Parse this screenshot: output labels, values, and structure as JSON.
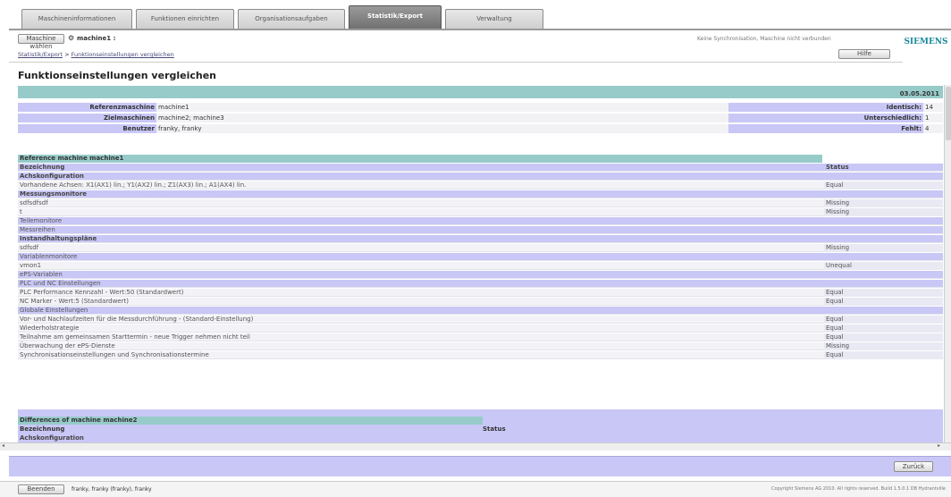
{
  "tabs": [
    {
      "label": "Maschineninformationen"
    },
    {
      "label": "Funktionen einrichten"
    },
    {
      "label": "Organisationsaufgaben"
    },
    {
      "label": "Statistik/Export"
    },
    {
      "label": "Verwaltung"
    }
  ],
  "toolbar": {
    "select_machine_label": "Maschine wählen",
    "machine_name": "machine1 :",
    "sync_status": "Keine Synchronisation, Maschine nicht verbunden",
    "help_label": "Hilfe",
    "brand": "SIEMENS"
  },
  "breadcrumb": {
    "root": "Statistik/Export",
    "separator": " > ",
    "current": "Funktionseinstellungen vergleichen"
  },
  "page_title": "Funktionseinstellungen vergleichen",
  "summary": {
    "date": "03.05.2011",
    "left": [
      {
        "label": "Referenzmaschine",
        "value": "machine1"
      },
      {
        "label": "Zielmaschinen",
        "value": "machine2; machine3"
      },
      {
        "label": "Benutzer",
        "value": "franky, franky"
      }
    ],
    "right": [
      {
        "label": "Identisch:",
        "value": "14"
      },
      {
        "label": "Unterschiedlich:",
        "value": "1"
      },
      {
        "label": "Fehlt:",
        "value": "4"
      }
    ]
  },
  "table1": {
    "title": "Reference machine machine1",
    "col_name": "Bezeichnung",
    "col_status": "Status",
    "rows": [
      {
        "kind": "sec",
        "name": "Achskonfiguration",
        "status": ""
      },
      {
        "kind": "item",
        "name": "Vorhandene Achsen: X1(AX1) lin.; Y1(AX2) lin.; Z1(AX3) lin.; A1(AX4) lin.",
        "status": "Equal"
      },
      {
        "kind": "sec",
        "name": "Messungsmonitore",
        "status": ""
      },
      {
        "kind": "item",
        "name": "sdfsdfsdf",
        "status": "Missing"
      },
      {
        "kind": "item",
        "name": "t",
        "status": "Missing"
      },
      {
        "kind": "sec2",
        "name": "Teilemonitore",
        "status": ""
      },
      {
        "kind": "sec2",
        "name": "Messreihen",
        "status": ""
      },
      {
        "kind": "sec",
        "name": "Instandhaltungspläne",
        "status": ""
      },
      {
        "kind": "item",
        "name": "sdfsdf",
        "status": "Missing"
      },
      {
        "kind": "sec2",
        "name": "Variablenmonitore",
        "status": ""
      },
      {
        "kind": "item",
        "name": "vmon1",
        "status": "Unequal"
      },
      {
        "kind": "sec2",
        "name": "ePS-Variablen",
        "status": ""
      },
      {
        "kind": "sec2",
        "name": "PLC und NC Einstellungen",
        "status": ""
      },
      {
        "kind": "item",
        "name": "PLC Performance Kennzahl - Wert:50 (Standardwert)",
        "status": "Equal"
      },
      {
        "kind": "item",
        "name": "NC Marker - Wert:5 (Standardwert)",
        "status": "Equal"
      },
      {
        "kind": "sec2",
        "name": "Globale Einstellungen",
        "status": ""
      },
      {
        "kind": "item",
        "name": "Vor- und Nachlaufzeiten für die Messdurchführung - (Standard-Einstellung)",
        "status": "Equal"
      },
      {
        "kind": "item",
        "name": "Wiederholstrategie",
        "status": "Equal"
      },
      {
        "kind": "item",
        "name": "Teilnahme am gemeinsamen Starttermin - neue Trigger nehmen nicht teil",
        "status": "Equal"
      },
      {
        "kind": "item",
        "name": "Überwachung der ePS-Dienste",
        "status": "Missing"
      },
      {
        "kind": "item",
        "name": "Synchronisationseinstellungen und Synchronisationstermine",
        "status": "Equal"
      }
    ]
  },
  "table2": {
    "title": "Differences of machine machine2",
    "col_name": "Bezeichnung",
    "col_status": "Status",
    "partial_row": "Achskonfiguration"
  },
  "back_label": "Zurück",
  "footer": {
    "logout_label": "Beenden",
    "user": "franky, franky (franky), franky",
    "copyright": "Copyright Siemens AG 2010. All rights reserved. Build 1.5.0.1 DB Hydrantville"
  },
  "colors": {
    "teal": "#96cbc9",
    "lavender": "#c9c7f6",
    "brand": "#1a8a9a"
  }
}
